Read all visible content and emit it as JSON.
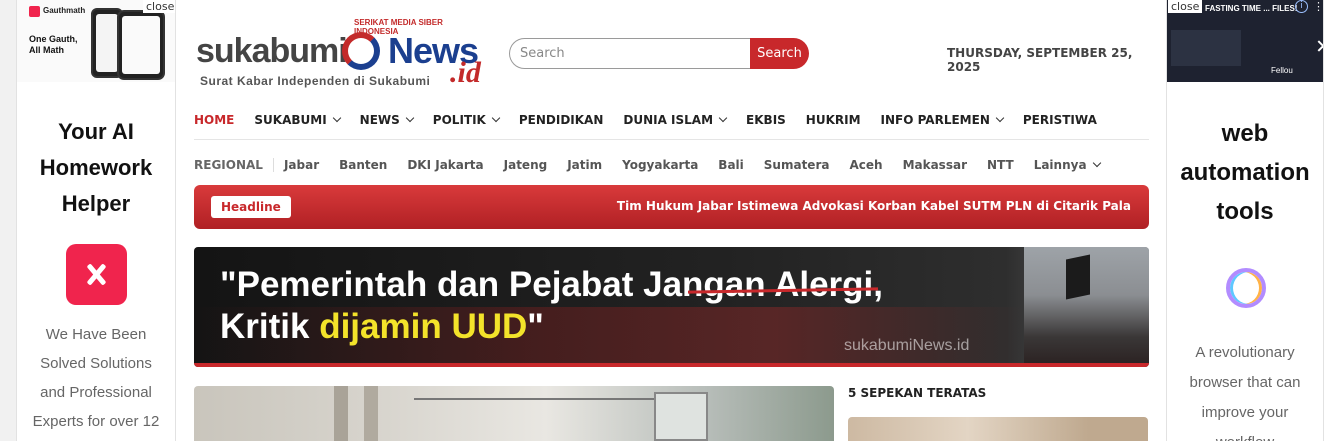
{
  "left_ad": {
    "close_label": "close",
    "thumb_brand": "Gauthmath",
    "thumb_text": "One Gauth, All Math",
    "headline": "Your AI Homework Helper",
    "body": "We Have Been Solved Solutions and Professional Experts for over 12",
    "icon": "gauth-x-logo-icon",
    "accent": "#f0244d"
  },
  "right_ad": {
    "close_label": "close",
    "thumb_text": "FASTING TIME ... FILES!",
    "thumb_brand": "Fellou",
    "headline": "web automation tools",
    "body": "A revolutionary browser that can improve your workflow",
    "icon": "rainbow-ring-logo-icon"
  },
  "header": {
    "logo_tag": "SERIKAT MEDIA SIBER INDONESIA",
    "logo_word": "sukabumi",
    "logo_news": "News",
    "logo_id": ".id",
    "logo_sub": "Surat Kabar Independen di Sukabumi",
    "search_placeholder": "Search",
    "search_button": "Search",
    "date": "THURSDAY, SEPTEMBER 25, 2025"
  },
  "nav": {
    "items": [
      {
        "label": "HOME",
        "active": true
      },
      {
        "label": "SUKABUMI",
        "dropdown": true
      },
      {
        "label": "NEWS",
        "dropdown": true
      },
      {
        "label": "POLITIK",
        "dropdown": true
      },
      {
        "label": "PENDIDIKAN"
      },
      {
        "label": "DUNIA ISLAM",
        "dropdown": true
      },
      {
        "label": "EKBIS"
      },
      {
        "label": "HUKRIM"
      },
      {
        "label": "INFO PARLEMEN",
        "dropdown": true
      },
      {
        "label": "PERISTIWA"
      }
    ]
  },
  "regional": {
    "label": "REGIONAL",
    "items": [
      "Jabar",
      "Banten",
      "DKI Jakarta",
      "Jateng",
      "Jatim",
      "Yogyakarta",
      "Bali",
      "Sumatera",
      "Aceh",
      "Makassar",
      "NTT"
    ],
    "more": "Lainnya"
  },
  "ticker": {
    "label": "Headline",
    "text": "Tim Hukum Jabar Istimewa Advokasi Korban Kabel SUTM PLN di Citarik Pala"
  },
  "banner": {
    "line1": "\"Pemerintah dan Pejabat Jangan Alergi,",
    "line2_start": "Kritik ",
    "line2_highlight": "dijamin UUD",
    "line2_end": "\"",
    "watermark": "sukabumiNews.id"
  },
  "sidebar": {
    "section_title": "5 SEPEKAN TERATAS"
  },
  "colors": {
    "accent": "#c8282b",
    "brand_blue": "#1b3f8f",
    "highlight_yellow": "#f3e32a"
  }
}
